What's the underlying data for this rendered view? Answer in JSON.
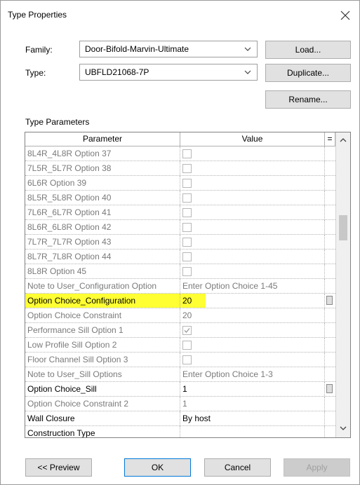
{
  "dialog": {
    "title": "Type Properties"
  },
  "family": {
    "label": "Family:",
    "value": "Door-Bifold-Marvin-Ultimate"
  },
  "type": {
    "label": "Type:",
    "value": "UBFLD21068-7P"
  },
  "buttons": {
    "load": "Load...",
    "duplicate": "Duplicate...",
    "rename": "Rename...",
    "preview": "<< Preview",
    "ok": "OK",
    "cancel": "Cancel",
    "apply": "Apply"
  },
  "type_parameters": {
    "label": "Type Parameters",
    "headers": {
      "parameter": "Parameter",
      "value": "Value",
      "eq": "="
    },
    "rows": [
      {
        "parameter": "8L4R_4L8R Option 37",
        "value": "",
        "kind": "checkbox",
        "checked": false,
        "grey": true
      },
      {
        "parameter": "7L5R_5L7R Option 38",
        "value": "",
        "kind": "checkbox",
        "checked": false,
        "grey": true
      },
      {
        "parameter": "6L6R Option 39",
        "value": "",
        "kind": "checkbox",
        "checked": false,
        "grey": true
      },
      {
        "parameter": "8L5R_5L8R Option 40",
        "value": "",
        "kind": "checkbox",
        "checked": false,
        "grey": true
      },
      {
        "parameter": "7L6R_6L7R Option 41",
        "value": "",
        "kind": "checkbox",
        "checked": false,
        "grey": true
      },
      {
        "parameter": "8L6R_6L8R Option 42",
        "value": "",
        "kind": "checkbox",
        "checked": false,
        "grey": true
      },
      {
        "parameter": "7L7R_7L7R Option 43",
        "value": "",
        "kind": "checkbox",
        "checked": false,
        "grey": true
      },
      {
        "parameter": "8L7R_7L8R Option 44",
        "value": "",
        "kind": "checkbox",
        "checked": false,
        "grey": true
      },
      {
        "parameter": "8L8R Option 45",
        "value": "",
        "kind": "checkbox",
        "checked": false,
        "grey": true
      },
      {
        "parameter": "Note to User_Configuration Option",
        "value": "Enter Option Choice 1-45",
        "kind": "text",
        "grey": true
      },
      {
        "parameter": "Option Choice_Configuration",
        "value": "20",
        "kind": "text",
        "grey": false,
        "highlight": true,
        "formula": true
      },
      {
        "parameter": "Option Choice Constraint",
        "value": "20",
        "kind": "text",
        "grey": true
      },
      {
        "parameter": "Performance Sill Option 1",
        "value": "",
        "kind": "checkbox",
        "checked": true,
        "grey": true
      },
      {
        "parameter": "Low Profile Sill Option 2",
        "value": "",
        "kind": "checkbox",
        "checked": false,
        "grey": true
      },
      {
        "parameter": "Floor Channel Sill Option 3",
        "value": "",
        "kind": "checkbox",
        "checked": false,
        "grey": true
      },
      {
        "parameter": "Note to User_Sill Options",
        "value": "Enter Option Choice 1-3",
        "kind": "text",
        "grey": true
      },
      {
        "parameter": "Option Choice_Sill",
        "value": "1",
        "kind": "text",
        "grey": false,
        "formula": true
      },
      {
        "parameter": "Option Choice Constraint 2",
        "value": "1",
        "kind": "text",
        "grey": true
      },
      {
        "parameter": "Wall Closure",
        "value": "By host",
        "kind": "text",
        "grey": false
      },
      {
        "parameter": "Construction Type",
        "value": "",
        "kind": "text",
        "grey": false
      }
    ]
  },
  "icons": {
    "close": "close-icon",
    "dropdown": "chevron-down-icon",
    "scroll_up": "chevron-up-icon",
    "scroll_down": "chevron-down-icon",
    "check": "checkmark-icon"
  },
  "colors": {
    "highlight": "#ffff33",
    "default_button_border": "#0078d7",
    "disabled_text": "#a0a0a0"
  }
}
